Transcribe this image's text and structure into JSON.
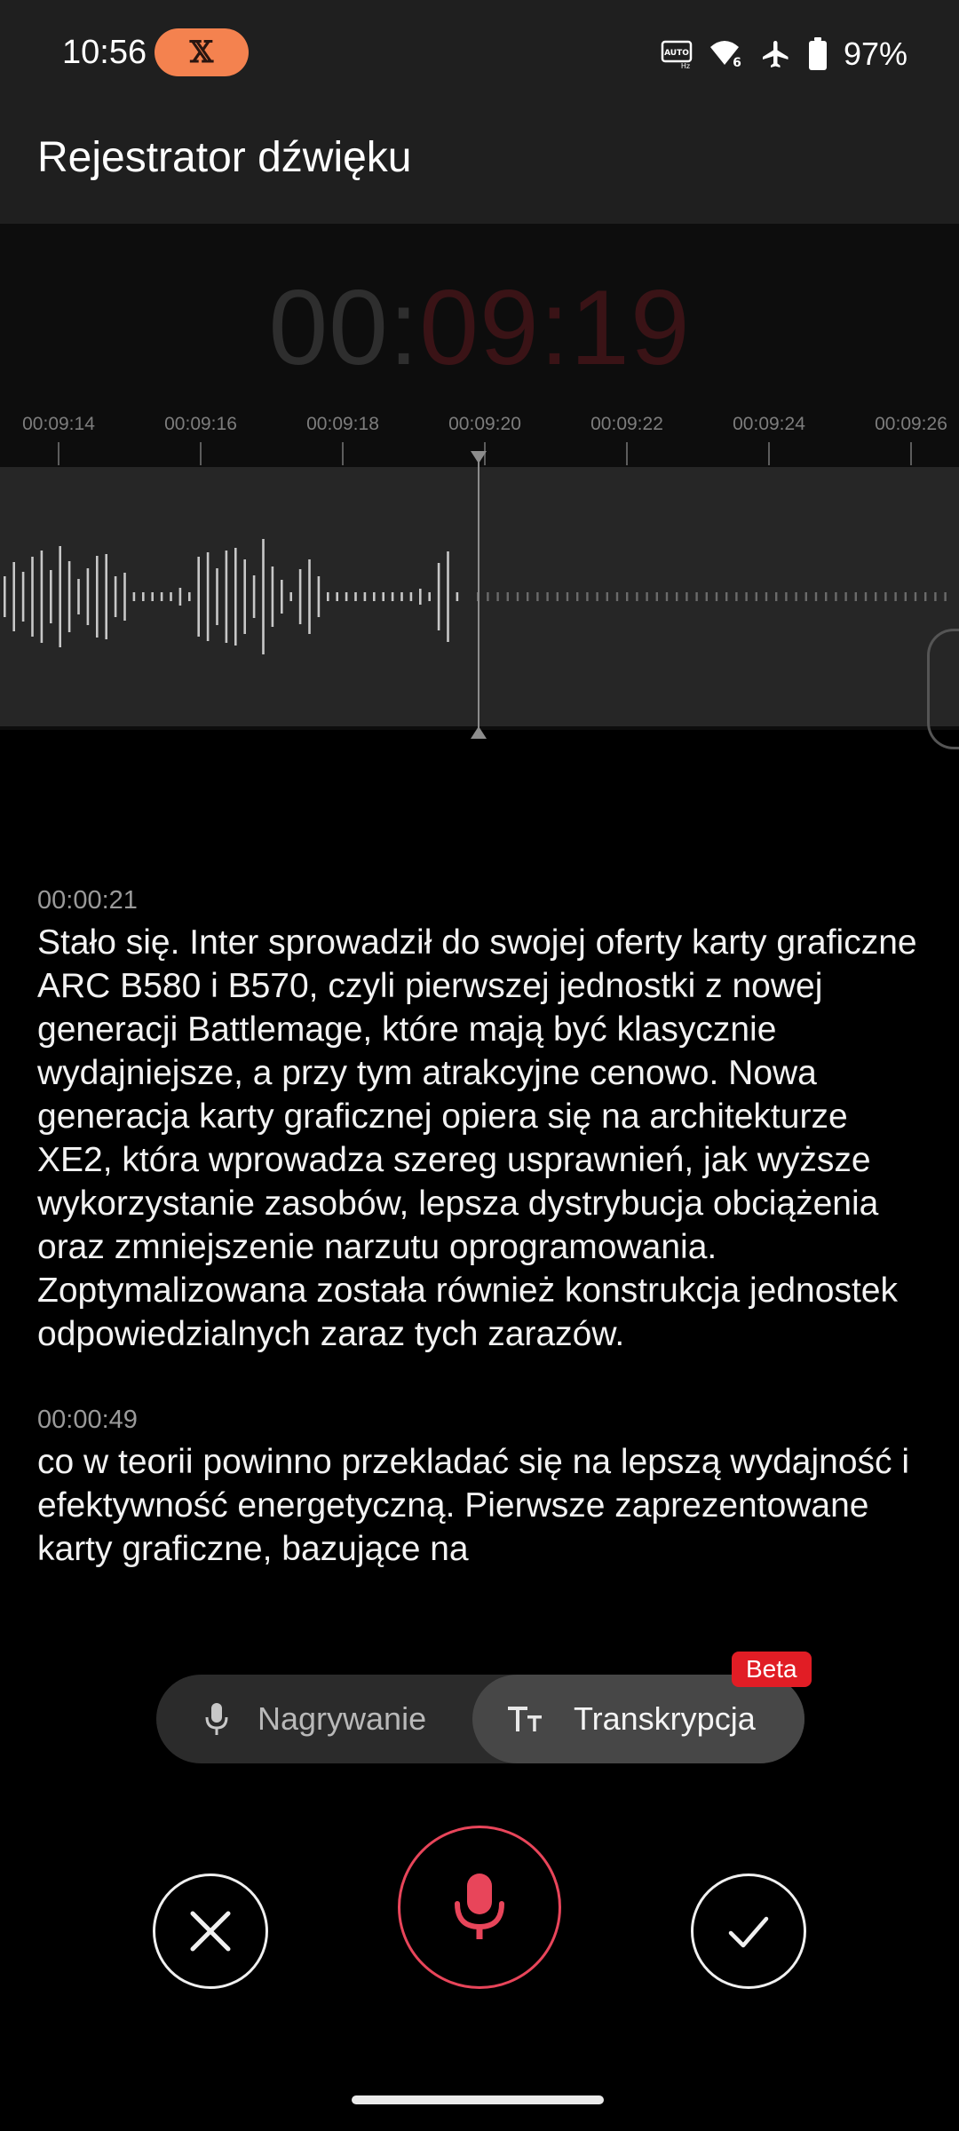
{
  "status_bar": {
    "time": "10:56",
    "battery_percent": "97%",
    "icons": [
      "x-logo-icon",
      "auto-hz-icon",
      "wifi-6-icon",
      "airplane-icon",
      "battery-icon"
    ]
  },
  "app_bar": {
    "title": "Rejestrator dźwięku"
  },
  "timer": {
    "part_minutes_hours": "00:",
    "part_seconds": "09:19"
  },
  "timeline": {
    "ticks": [
      "00:09:14",
      "00:09:16",
      "00:09:18",
      "00:09:20",
      "00:09:22",
      "00:09:24",
      "00:09:26"
    ],
    "recorded_fraction": 0.49
  },
  "transcript": {
    "segments": [
      {
        "time": "00:00:21",
        "text": "Stało się. Inter sprowadził do swojej oferty karty graficzne ARC B580 i B570, czyli pierwszej jednostki z nowej generacji Battlemage, które mają być klasycznie wydajniejsze, a przy tym atrakcyjne cenowo. Nowa generacja karty graficznej opiera się na architekturze XE2, która wprowadza szereg usprawnień, jak wyższe wykorzystanie zasobów, lepsza dystrybucja obciążenia oraz zmniejszenie narzutu oprogramowania. Zoptymalizowana została również konstrukcja jednostek odpowiedzialnych zaraz tych zarazów."
      },
      {
        "time": "00:00:49",
        "text": "co w teorii powinno przekladać się na lepszą wydajność i efektywność energetyczną. Pierwsze zaprezentowane karty graficzne, bazujące na"
      }
    ]
  },
  "mode_toggle": {
    "recording_label": "Nagrywanie",
    "transcription_label": "Transkrypcja",
    "badge": "Beta",
    "selected": "Transkrypcja"
  },
  "colors": {
    "accent_red": "#e8455a",
    "badge_red": "#e11d25",
    "x_pill": "#f4824f"
  }
}
